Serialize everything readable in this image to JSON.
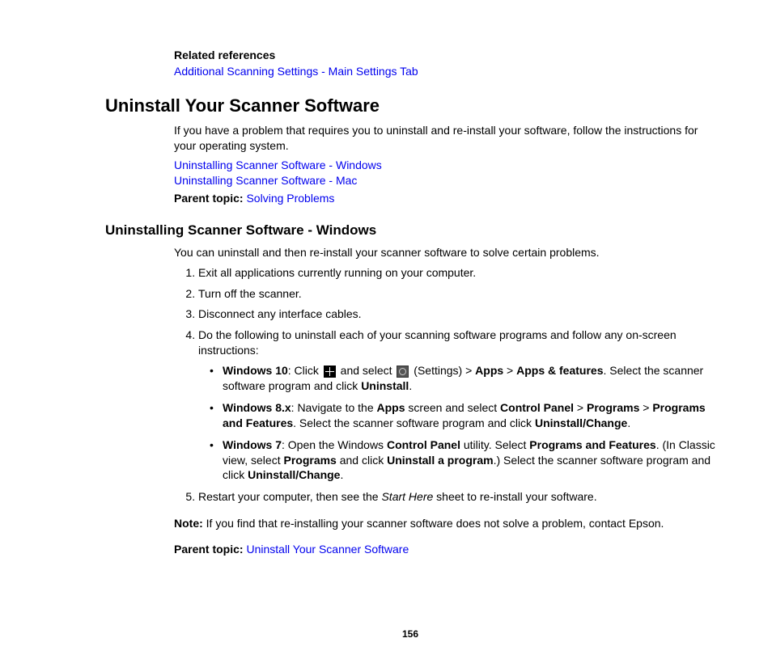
{
  "relatedReferences": {
    "label": "Related references",
    "link1": "Additional Scanning Settings - Main Settings Tab"
  },
  "h1": "Uninstall Your Scanner Software",
  "intro": "If you have a problem that requires you to uninstall and re-install your software, follow the instructions for your operating system.",
  "links": {
    "windows": "Uninstalling Scanner Software - Windows",
    "mac": "Uninstalling Scanner Software - Mac"
  },
  "parentTopic1": {
    "label": "Parent topic:",
    "link": "Solving Problems"
  },
  "h2": "Uninstalling Scanner Software - Windows",
  "subIntro": "You can uninstall and then re-install your scanner software to solve certain problems.",
  "steps": {
    "s1": "Exit all applications currently running on your computer.",
    "s2": "Turn off the scanner.",
    "s3": "Disconnect any interface cables.",
    "s4": "Do the following to uninstall each of your scanning software programs and follow any on-screen instructions:",
    "s5a": "Restart your computer, then see the ",
    "s5italic": "Start Here",
    "s5b": " sheet to re-install your software."
  },
  "win10": {
    "label": "Windows 10",
    "t1": ": Click ",
    "t2": " and select ",
    "t3": " (Settings) > ",
    "apps": "Apps",
    "gt": " > ",
    "appsFeatures": "Apps & features",
    "t4": ". Select the scanner software program and click ",
    "uninstall": "Uninstall",
    "period": "."
  },
  "win8": {
    "label": "Windows 8.x",
    "t1": ": Navigate to the ",
    "appsScreen": "Apps",
    "t2": " screen and select ",
    "cp": "Control Panel",
    "gt": " > ",
    "programs": "Programs",
    "pf": "Programs and Features",
    "t3": ". Select the scanner software program and click ",
    "uc": "Uninstall/Change",
    "period": "."
  },
  "win7": {
    "label": "Windows 7",
    "t1": ": Open the Windows ",
    "cp": "Control Panel",
    "t2": " utility. Select ",
    "pf": "Programs and Features",
    "t3": ". (In Classic view, select ",
    "programs": "Programs",
    "t4": " and click ",
    "uap": "Uninstall a program",
    "t5": ".) Select the scanner software program and click ",
    "uc": "Uninstall/Change",
    "period": "."
  },
  "note": {
    "label": "Note:",
    "text": " If you find that re-installing your scanner software does not solve a problem, contact Epson."
  },
  "parentTopic2": {
    "label": "Parent topic:",
    "link": "Uninstall Your Scanner Software"
  },
  "pageNumber": "156"
}
